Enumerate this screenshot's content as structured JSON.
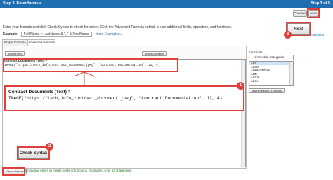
{
  "header": {
    "step_title": "Step 3. Enter formula",
    "step_count": "Step 3 of 5"
  },
  "nav": {
    "previous_label": "Previous",
    "next_label": "Next",
    "next_zoom_label": "Next"
  },
  "instructions": "Enter your formula and click Check Syntax to check for errors. Click the Advanced Formula subtab to use additional fields, operators, and functions.",
  "example": {
    "label": "Example:",
    "value": "Full Name = LastName & \", \" & FirstName",
    "more_link": "More Examples..."
  },
  "tabs": [
    {
      "label": "Simple Formula"
    },
    {
      "label": "Advanced Formula"
    }
  ],
  "editor": {
    "insert_field_label": "Insert Field",
    "insert_operator_label": "Insert Operator",
    "formula_label": "Contract Documents (Text) =",
    "formula_text": "IMAGE(\"https://tech_info_contract_document.jpeg\", \"Contract Documentation\", 12, 4)",
    "check_syntax_label": "Check Syntax",
    "status": "No syntax errors in merge fields or functions. (Compiled size: 53 characters)"
  },
  "zoom": {
    "formula_label": "Contract Documents (Text) =",
    "formula_text": "IMAGE(\"https://tech_info_contract_document.jpeg\", \"Contract Documentation\", 12, 4)",
    "check_syntax_label": "Check Syntax"
  },
  "functions": {
    "label": "Functions",
    "category": "-- All Function Categories --",
    "items": [
      "ABS",
      "ACOS",
      "ADDMONTHS",
      "AND",
      "ASCII",
      "ASIN"
    ],
    "insert_label": "Insert Selected Function"
  },
  "behind_text": {
    "line1": "rted",
    "line2": "s & Functions"
  },
  "badges": {
    "one": "1",
    "two": "2",
    "three": "3"
  },
  "colors": {
    "header": "#1f6fb0",
    "callout": "#e0403a"
  }
}
